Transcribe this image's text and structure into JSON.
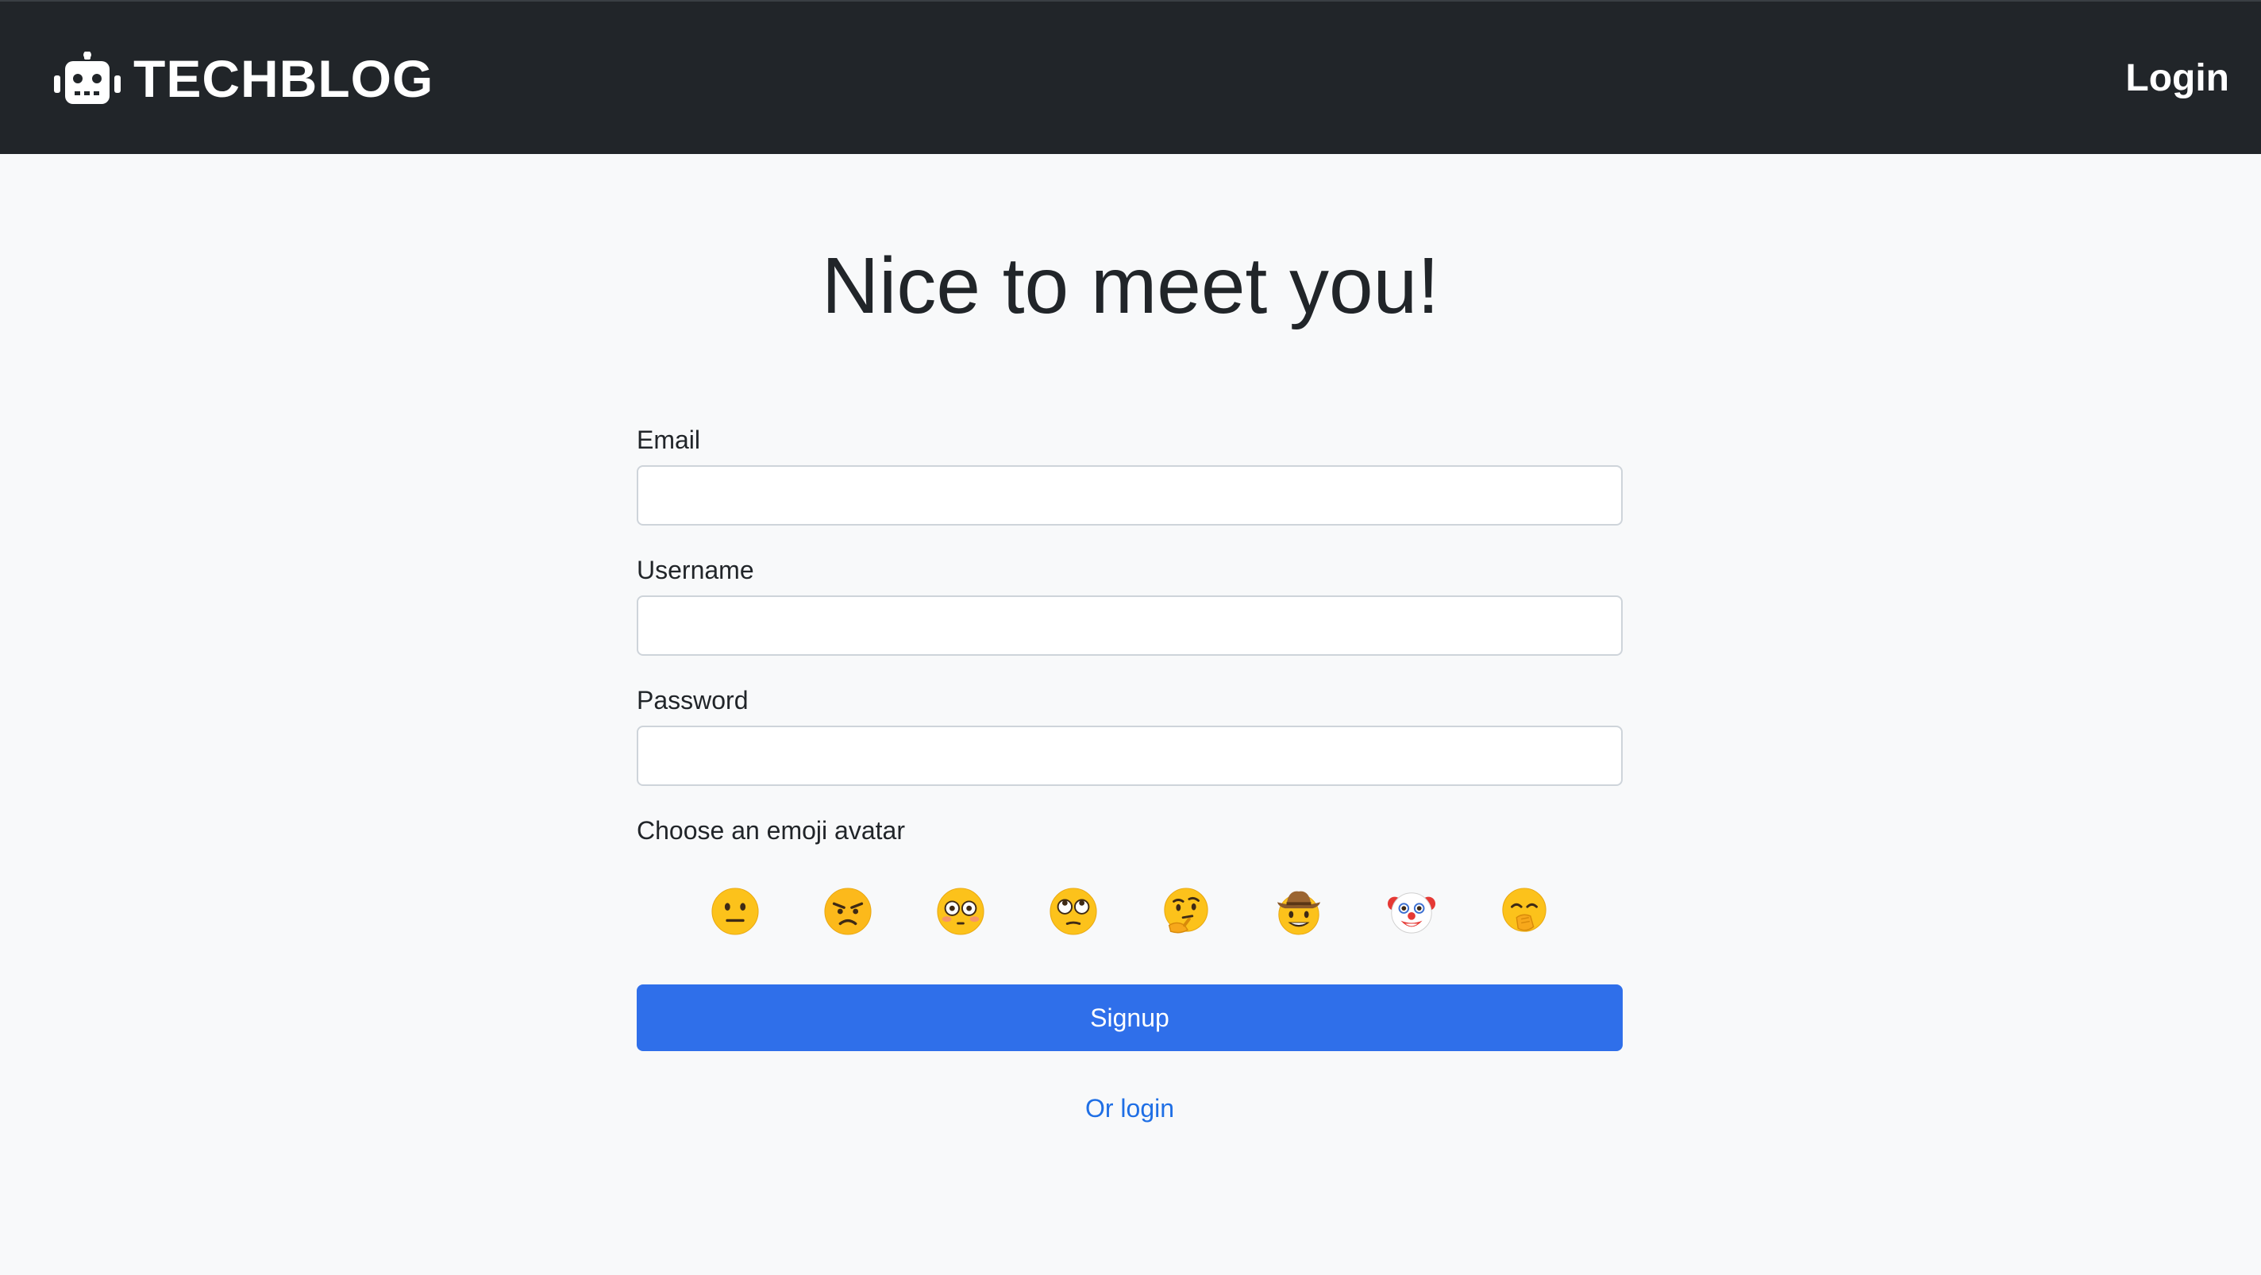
{
  "navbar": {
    "brand_icon": "robot-icon",
    "brand_text": "TECHBLOG",
    "login_label": "Login",
    "background": "#212529"
  },
  "main": {
    "title": "Nice to meet you!"
  },
  "form": {
    "email_label": "Email",
    "email_value": "",
    "username_label": "Username",
    "username_value": "",
    "password_label": "Password",
    "password_value": "",
    "emoji_label": "Choose an emoji avatar",
    "emojis": [
      {
        "name": "neutral-face-emoji"
      },
      {
        "name": "angry-face-emoji"
      },
      {
        "name": "flushed-face-emoji"
      },
      {
        "name": "rolling-eyes-face-emoji"
      },
      {
        "name": "thinking-face-emoji"
      },
      {
        "name": "cowboy-face-emoji"
      },
      {
        "name": "clown-face-emoji"
      },
      {
        "name": "face-with-hand-over-mouth-emoji"
      }
    ],
    "signup_label": "Signup",
    "signup_color": "#2f6fea",
    "or_login_label": "Or login",
    "link_color": "#1f6fe5"
  }
}
